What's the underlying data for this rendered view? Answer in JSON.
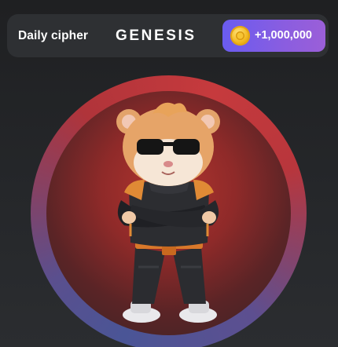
{
  "cipher": {
    "label": "Daily cipher",
    "word": "GENESIS"
  },
  "reward": {
    "amount": "+1,000,000",
    "icon": "coin-icon"
  },
  "tap_area": {
    "character_icon": "hamster-icon"
  },
  "colors": {
    "background": "#222325",
    "bar_background": "#2e3033",
    "button_gradient_start": "#6a5cf0",
    "button_gradient_end": "#9b5fd8",
    "ring_red": "#c63a3d",
    "ring_blue": "#4a5596",
    "coin_gold": "#f2b81e"
  }
}
